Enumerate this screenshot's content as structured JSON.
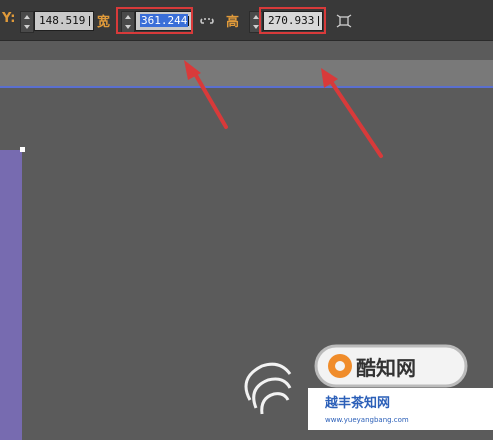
{
  "toolbar": {
    "y_label": "Y:",
    "y_value": "148.519",
    "width_label": "宽",
    "width_value": "361.244",
    "height_label": "高",
    "height_value": "270.933"
  },
  "icons": {
    "link": "link-icon",
    "frame": "fit-frame-icon"
  },
  "colors": {
    "highlight": "#d83a3a",
    "selection": "#3a6ed8",
    "shape": "#776bb0",
    "guide": "#5a6fcf"
  },
  "watermark": {
    "text_main": "酷知网",
    "text_cn": "越丰茶知网",
    "url": "www.yueyangbang.com"
  }
}
